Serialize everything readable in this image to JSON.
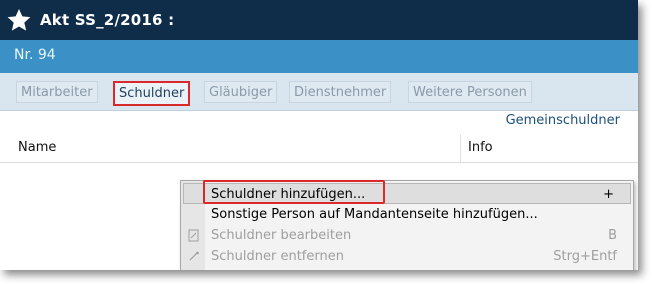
{
  "window": {
    "title": "Akt SS_2/2016 :",
    "icon": "star-icon"
  },
  "record": {
    "number": "Nr. 94"
  },
  "tabs": [
    {
      "label": "Mitarbeiter",
      "active": false
    },
    {
      "label": "Schuldner",
      "active": true
    },
    {
      "label": "Gläubiger",
      "active": false
    },
    {
      "label": "Dienstnehmer",
      "active": false
    },
    {
      "label": "Weitere Personen",
      "active": false
    }
  ],
  "section": {
    "right_label": "Gemeinschuldner"
  },
  "table": {
    "columns": [
      "Name",
      "Info"
    ]
  },
  "context_menu": {
    "items": [
      {
        "label": "Schuldner hinzufügen...",
        "shortcut": "+",
        "enabled": true,
        "highlighted": true,
        "icon": ""
      },
      {
        "label": "Sonstige Person auf Mandantenseite hinzufügen...",
        "shortcut": "",
        "enabled": true,
        "highlighted": false,
        "icon": ""
      },
      {
        "label": "Schuldner bearbeiten",
        "shortcut": "B",
        "enabled": false,
        "highlighted": false,
        "icon": "edit-icon"
      },
      {
        "label": "Schuldner entfernen",
        "shortcut": "Strg+Entf",
        "enabled": false,
        "highlighted": false,
        "icon": "remove-icon"
      }
    ]
  },
  "colors": {
    "titlebar": "#0f2c49",
    "subbar": "#3b90c6",
    "tabsbar": "#d9e6f0",
    "highlight_box": "#d9292b"
  }
}
